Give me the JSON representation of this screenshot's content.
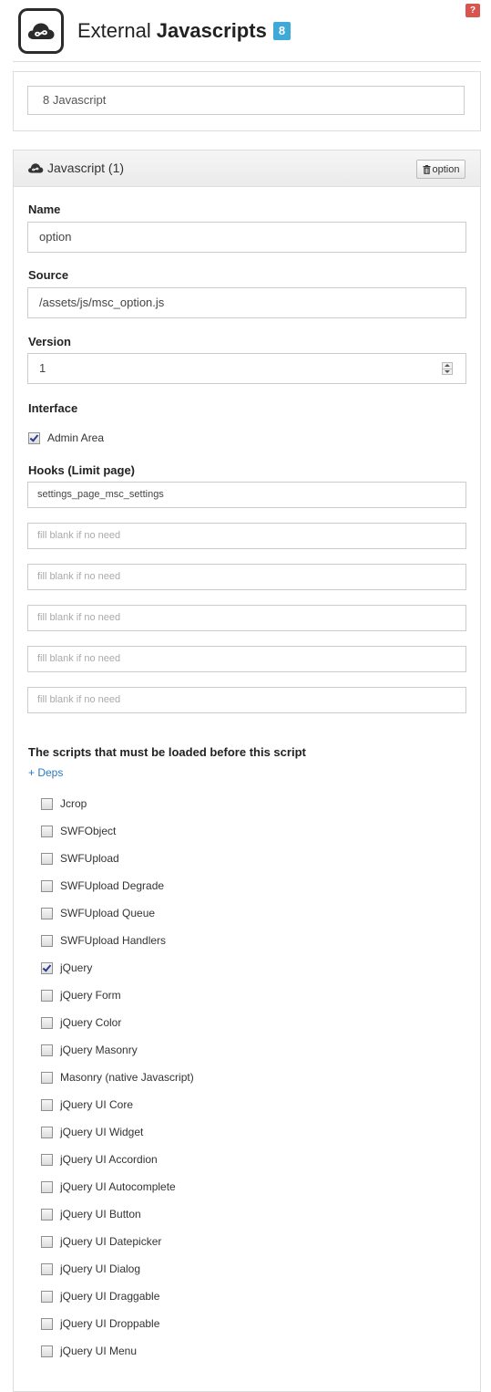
{
  "help_label": "?",
  "header": {
    "title_light": "External",
    "title_bold": "Javascripts",
    "count": "8",
    "logo_icon": "cloud-infinity-icon"
  },
  "summary": {
    "value": "8 Javascript"
  },
  "panel": {
    "title": "Javascript (1)",
    "option_label": "option",
    "name_label": "Name",
    "name_value": "option",
    "source_label": "Source",
    "source_value": "/assets/js/msc_option.js",
    "version_label": "Version",
    "version_value": "1",
    "interface_label": "Interface",
    "admin_area_label": "Admin Area",
    "admin_area_checked": true,
    "hooks_label": "Hooks (Limit page)",
    "hooks": [
      {
        "value": "settings_page_msc_settings",
        "placeholder": ""
      },
      {
        "value": "",
        "placeholder": "fill blank if no need"
      },
      {
        "value": "",
        "placeholder": "fill blank if no need"
      },
      {
        "value": "",
        "placeholder": "fill blank if no need"
      },
      {
        "value": "",
        "placeholder": "fill blank if no need"
      },
      {
        "value": "",
        "placeholder": "fill blank if no need"
      }
    ],
    "deps_title": "The scripts that must be loaded before this script",
    "deps_link": "+ Deps",
    "deps": [
      {
        "label": "Jcrop",
        "checked": false
      },
      {
        "label": "SWFObject",
        "checked": false
      },
      {
        "label": "SWFUpload",
        "checked": false
      },
      {
        "label": "SWFUpload Degrade",
        "checked": false
      },
      {
        "label": "SWFUpload Queue",
        "checked": false
      },
      {
        "label": "SWFUpload Handlers",
        "checked": false
      },
      {
        "label": "jQuery",
        "checked": true
      },
      {
        "label": "jQuery Form",
        "checked": false
      },
      {
        "label": "jQuery Color",
        "checked": false
      },
      {
        "label": "jQuery Masonry",
        "checked": false
      },
      {
        "label": "Masonry (native Javascript)",
        "checked": false
      },
      {
        "label": "jQuery UI Core",
        "checked": false
      },
      {
        "label": "jQuery UI Widget",
        "checked": false
      },
      {
        "label": "jQuery UI Accordion",
        "checked": false
      },
      {
        "label": "jQuery UI Autocomplete",
        "checked": false
      },
      {
        "label": "jQuery UI Button",
        "checked": false
      },
      {
        "label": "jQuery UI Datepicker",
        "checked": false
      },
      {
        "label": "jQuery UI Dialog",
        "checked": false
      },
      {
        "label": "jQuery UI Draggable",
        "checked": false
      },
      {
        "label": "jQuery UI Droppable",
        "checked": false
      },
      {
        "label": "jQuery UI Menu",
        "checked": false
      }
    ]
  },
  "colors": {
    "count_badge": "#3fa9d8",
    "help_badge": "#d9534f",
    "link": "#2a7bbf"
  }
}
